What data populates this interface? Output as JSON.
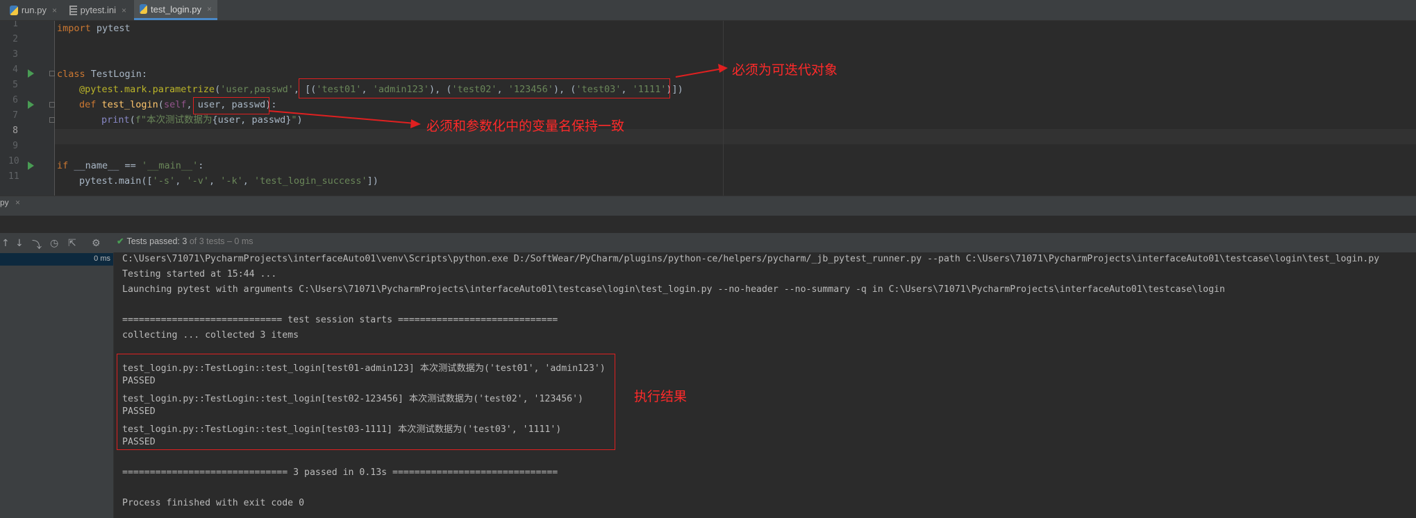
{
  "tabs": [
    {
      "label": "run.py",
      "close": "×",
      "icon": "python-file-icon"
    },
    {
      "label": "pytest.ini",
      "close": "×",
      "icon": "ini-file-icon"
    },
    {
      "label": "test_login.py",
      "close": "×",
      "icon": "python-file-icon",
      "active": true
    }
  ],
  "editor": {
    "line_numbers": [
      "1",
      "2",
      "3",
      "4",
      "5",
      "6",
      "7",
      "8",
      "9",
      "10",
      "11"
    ],
    "code": {
      "l1_kw": "import",
      "l1_rest": " pytest",
      "l4_kw": "class",
      "l4_rest": " TestLogin:",
      "l5_dec": "@pytest.mark.parametrize",
      "l5_p1": "(",
      "l5_s1": "'user,passwd'",
      "l5_p2": ", [(",
      "l5_s2": "'test01'",
      "l5_p3": ", ",
      "l5_s3": "'admin123'",
      "l5_p4": "), (",
      "l5_s4": "'test02'",
      "l5_p5": ", ",
      "l5_s5": "'123456'",
      "l5_p6": "), (",
      "l5_s6": "'test03'",
      "l5_p7": ", ",
      "l5_s7": "'1111'",
      "l5_p8": ")])",
      "l6_kw": "def",
      "l6_fn": " test_login",
      "l6_p1": "(",
      "l6_self": "self",
      "l6_p2": ", user, passwd):",
      "l7_blt": "print",
      "l7_p1": "(",
      "l7_f1": "f\"本次测试数据为",
      "l7_p2": "{user, passwd}",
      "l7_f2": "\"",
      "l7_p3": ")",
      "l10_kw": "if",
      "l10_p1": " __name__ == ",
      "l10_s1": "'__main__'",
      "l10_p2": ":",
      "l11_p1": "pytest.main([",
      "l11_s1": "'-s'",
      "l11_p2": ", ",
      "l11_s2": "'-v'",
      "l11_p3": ", ",
      "l11_s3": "'-k'",
      "l11_p4": ", ",
      "l11_s4": "'test_login_success'",
      "l11_p5": "])"
    }
  },
  "annotations": {
    "iterable_note": "必须为可迭代对象",
    "param_name_note": "必须和参数化中的变量名保持一致",
    "result_note": "执行结果"
  },
  "run_panel": {
    "tab_label": "py",
    "tab_close": "×",
    "status_label": "Tests passed: 3",
    "status_detail": " of 3 tests – 0 ms",
    "tree_time": "0 ms"
  },
  "console": {
    "lines": [
      "C:\\Users\\71071\\PycharmProjects\\interfaceAuto01\\venv\\Scripts\\python.exe D:/SoftWear/PyCharm/plugins/python-ce/helpers/pycharm/_jb_pytest_runner.py --path C:\\Users\\71071\\PycharmProjects\\interfaceAuto01\\testcase\\login\\test_login.py",
      "Testing started at 15:44 ...",
      "Launching pytest with arguments C:\\Users\\71071\\PycharmProjects\\interfaceAuto01\\testcase\\login\\test_login.py --no-header --no-summary -q in C:\\Users\\71071\\PycharmProjects\\interfaceAuto01\\testcase\\login",
      "",
      "============================= test session starts =============================",
      "collecting ... collected 3 items",
      "",
      "test_login.py::TestLogin::test_login[test01-admin123] 本次测试数据为('test01', 'admin123')",
      "PASSED",
      "test_login.py::TestLogin::test_login[test02-123456] 本次测试数据为('test02', '123456')",
      "PASSED",
      "test_login.py::TestLogin::test_login[test03-1111] 本次测试数据为('test03', '1111')",
      "PASSED",
      "",
      "============================== 3 passed in 0.13s ==============================",
      "",
      "Process finished with exit code 0"
    ]
  },
  "colors": {
    "annotation_red": "#ff2a2a",
    "keyword": "#cc7832",
    "string": "#6a8759",
    "run_green": "#499c54",
    "active_tab_accent": "#4a88c7"
  }
}
